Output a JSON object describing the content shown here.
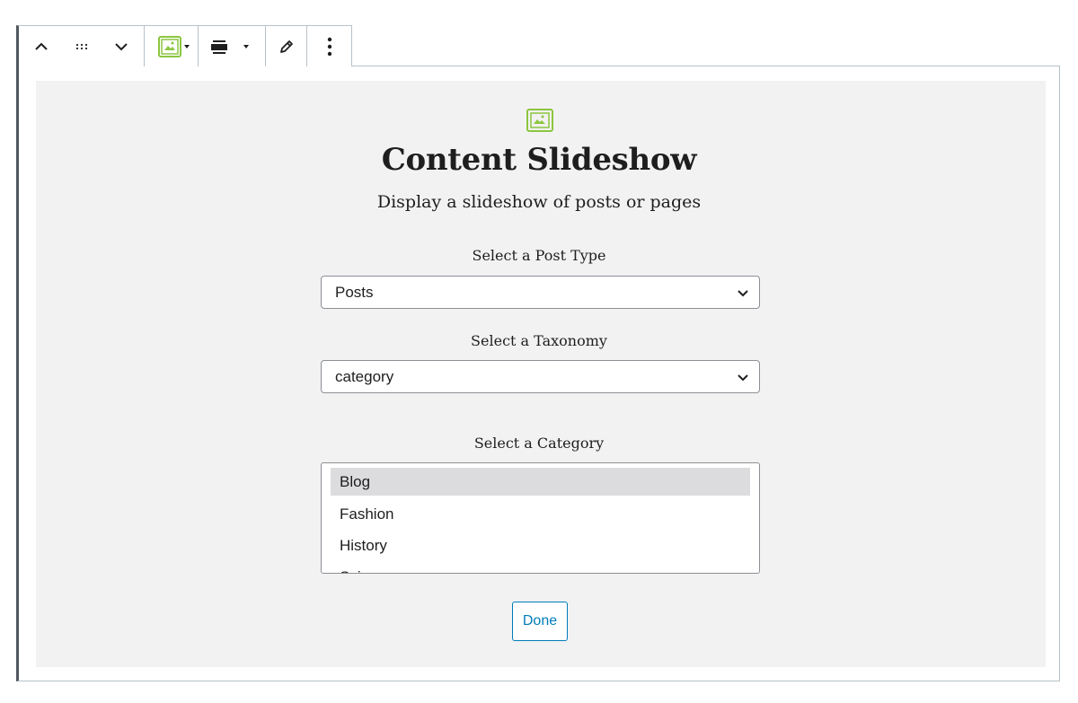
{
  "block": {
    "title": "Content Slideshow",
    "subtitle": "Display a slideshow of posts or pages",
    "icon": "slideshow-icon",
    "accent_color": "#8cc63f"
  },
  "toolbar": {
    "move_up": "chevron-up-icon",
    "drag": "drag-handle-icon",
    "move_down": "chevron-down-icon",
    "block_type": "slideshow-icon",
    "align": "align-center-icon",
    "edit": "pencil-icon",
    "more": "more-vertical-icon"
  },
  "post_type": {
    "label": "Select a Post Type",
    "value": "Posts"
  },
  "taxonomy": {
    "label": "Select a Taxonomy",
    "value": "category"
  },
  "category": {
    "label": "Select a Category",
    "items": [
      "Blog",
      "Fashion",
      "History",
      "Sci..."
    ],
    "selected": "Blog"
  },
  "done_label": "Done",
  "colors": {
    "button_blue": "#007cba",
    "placeholder_bg": "#f2f2f3",
    "selected_item_bg": "#dcdcde"
  }
}
